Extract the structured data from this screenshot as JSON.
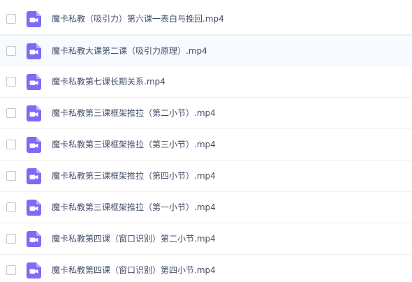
{
  "accent_color": "#7c6bf5",
  "files": [
    {
      "name": "魔卡私教（吸引力）第六课一表白与挽回.mp4",
      "icon": "video-file-icon",
      "highlighted": false
    },
    {
      "name": "魔卡私教大课第二课（吸引力原理）.mp4",
      "icon": "video-file-icon",
      "highlighted": true
    },
    {
      "name": "魔卡私教第七课长期关系.mp4",
      "icon": "video-file-icon",
      "highlighted": false
    },
    {
      "name": "魔卡私教第三课框架推拉（第二小节）.mp4",
      "icon": "video-file-icon",
      "highlighted": false
    },
    {
      "name": "魔卡私教第三课框架推拉（第三小节）.mp4",
      "icon": "video-file-icon",
      "highlighted": false
    },
    {
      "name": "魔卡私教第三课框架推拉（第四小节）.mp4",
      "icon": "video-file-icon",
      "highlighted": false
    },
    {
      "name": "魔卡私教第三课框架推拉（第一小节）.mp4",
      "icon": "video-file-icon",
      "highlighted": false
    },
    {
      "name": "魔卡私教第四课（窗口识别）第二小节.mp4",
      "icon": "video-file-icon",
      "highlighted": false
    },
    {
      "name": "魔卡私教第四课（窗口识别）第四小节.mp4",
      "icon": "video-file-icon",
      "highlighted": false
    }
  ]
}
